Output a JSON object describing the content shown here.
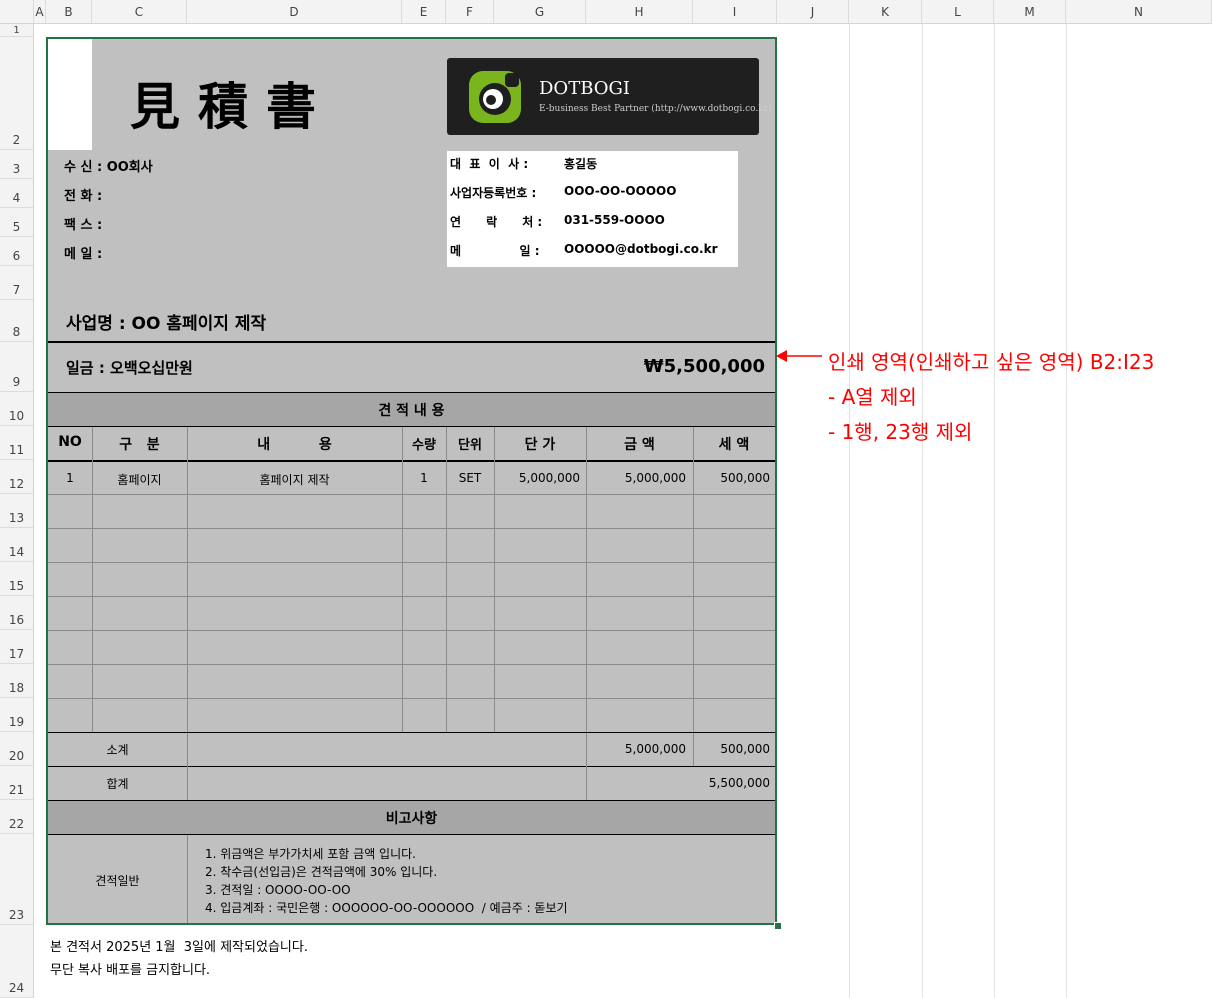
{
  "columns": [
    "A",
    "B",
    "C",
    "D",
    "E",
    "F",
    "G",
    "H",
    "I",
    "J",
    "K",
    "L",
    "M",
    "N"
  ],
  "rows": [
    "1",
    "2",
    "3",
    "4",
    "5",
    "6",
    "7",
    "8",
    "9",
    "10",
    "11",
    "12",
    "13",
    "14",
    "15",
    "16",
    "17",
    "18",
    "19",
    "20",
    "21",
    "22",
    "23",
    "24"
  ],
  "title": "見積書",
  "logo": {
    "name": "DOTBOGI",
    "tagline": "E-business Best Partner  (http://www.dotbogi.co.kr)"
  },
  "recipient": {
    "to": "수  신 : OO회사",
    "phone": "전  화 :",
    "fax": "팩  스 :",
    "email": "메  일 :"
  },
  "company": {
    "ceo_label": "대  표  이  사 :",
    "ceo": "홍길동",
    "reg_label": "사업자등록번호 :",
    "reg": "OOO-OO-OOOOO",
    "contact_label": "연      락      처 :",
    "contact": "031-559-OOOO",
    "mail_label": "메              일 :",
    "mail": "OOOOO@dotbogi.co.kr"
  },
  "project": "사업명 : OO 홈페이지 제작",
  "amount_words": "일금 : 오백오십만원",
  "amount": "₩5,500,000",
  "section_title": "견 적 내 용",
  "table_headers": [
    "NO",
    "구   분",
    "내          용",
    "수량",
    "단위",
    "단 가",
    "금 액",
    "세 액"
  ],
  "table_row": [
    "1",
    "홈페이지",
    "홈페이지 제작",
    "1",
    "SET",
    "5,000,000",
    "5,000,000",
    "500,000"
  ],
  "subtotal": {
    "label": "소계",
    "amount": "5,000,000",
    "tax": "500,000"
  },
  "total": {
    "label": "합계",
    "amount": "5,500,000"
  },
  "remarks_title": "비고사항",
  "remarks_label": "견적일반",
  "remarks": [
    "1. 위금액은 부가가치세 포함 금액 입니다.",
    "2. 착수금(선입금)은 견적금액에 30% 입니다.",
    "3. 견적일 : OOOO-OO-OO",
    "4. 입금계좌 : 국민은행 : OOOOOO-OO-OOOOOO  / 예금주 : 돋보기"
  ],
  "footer": [
    "본 견적서 2025년 1월  3일에 제작되었습니다.",
    "무단 복사 배포를 금지합니다."
  ],
  "annotation": [
    "인쇄 영역(인쇄하고 싶은 영역) B2:I23",
    "- A열 제외",
    "- 1행, 23행 제외"
  ],
  "colors": {
    "annotation": "#ff0000",
    "sheet_bg": "#c0c0c0",
    "selection": "#217346",
    "logo_green": "#7ab51d"
  }
}
